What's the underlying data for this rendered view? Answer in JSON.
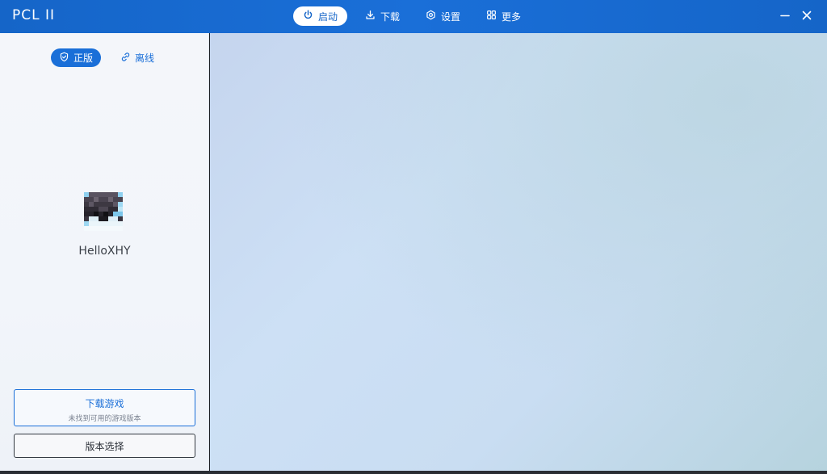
{
  "app": {
    "title": "PCL II"
  },
  "nav": {
    "launch": "启动",
    "download": "下载",
    "settings": "设置",
    "more": "更多"
  },
  "sidebar": {
    "mode_online": "正版",
    "mode_offline": "离线",
    "username": "HelloXHY",
    "download_button": {
      "label": "下载游戏",
      "sublabel": "未找到可用的游戏版本"
    },
    "version_button": {
      "label": "版本选择"
    }
  },
  "colors": {
    "accent": "#1a6fd8",
    "titlebar": "#1565c8"
  },
  "icons": {
    "launch": "power-icon",
    "download": "download-icon",
    "settings": "gear-icon",
    "more": "grid-icon",
    "online": "shield-check-icon",
    "offline": "link-icon",
    "minimize": "minimize-icon",
    "close": "close-icon"
  }
}
